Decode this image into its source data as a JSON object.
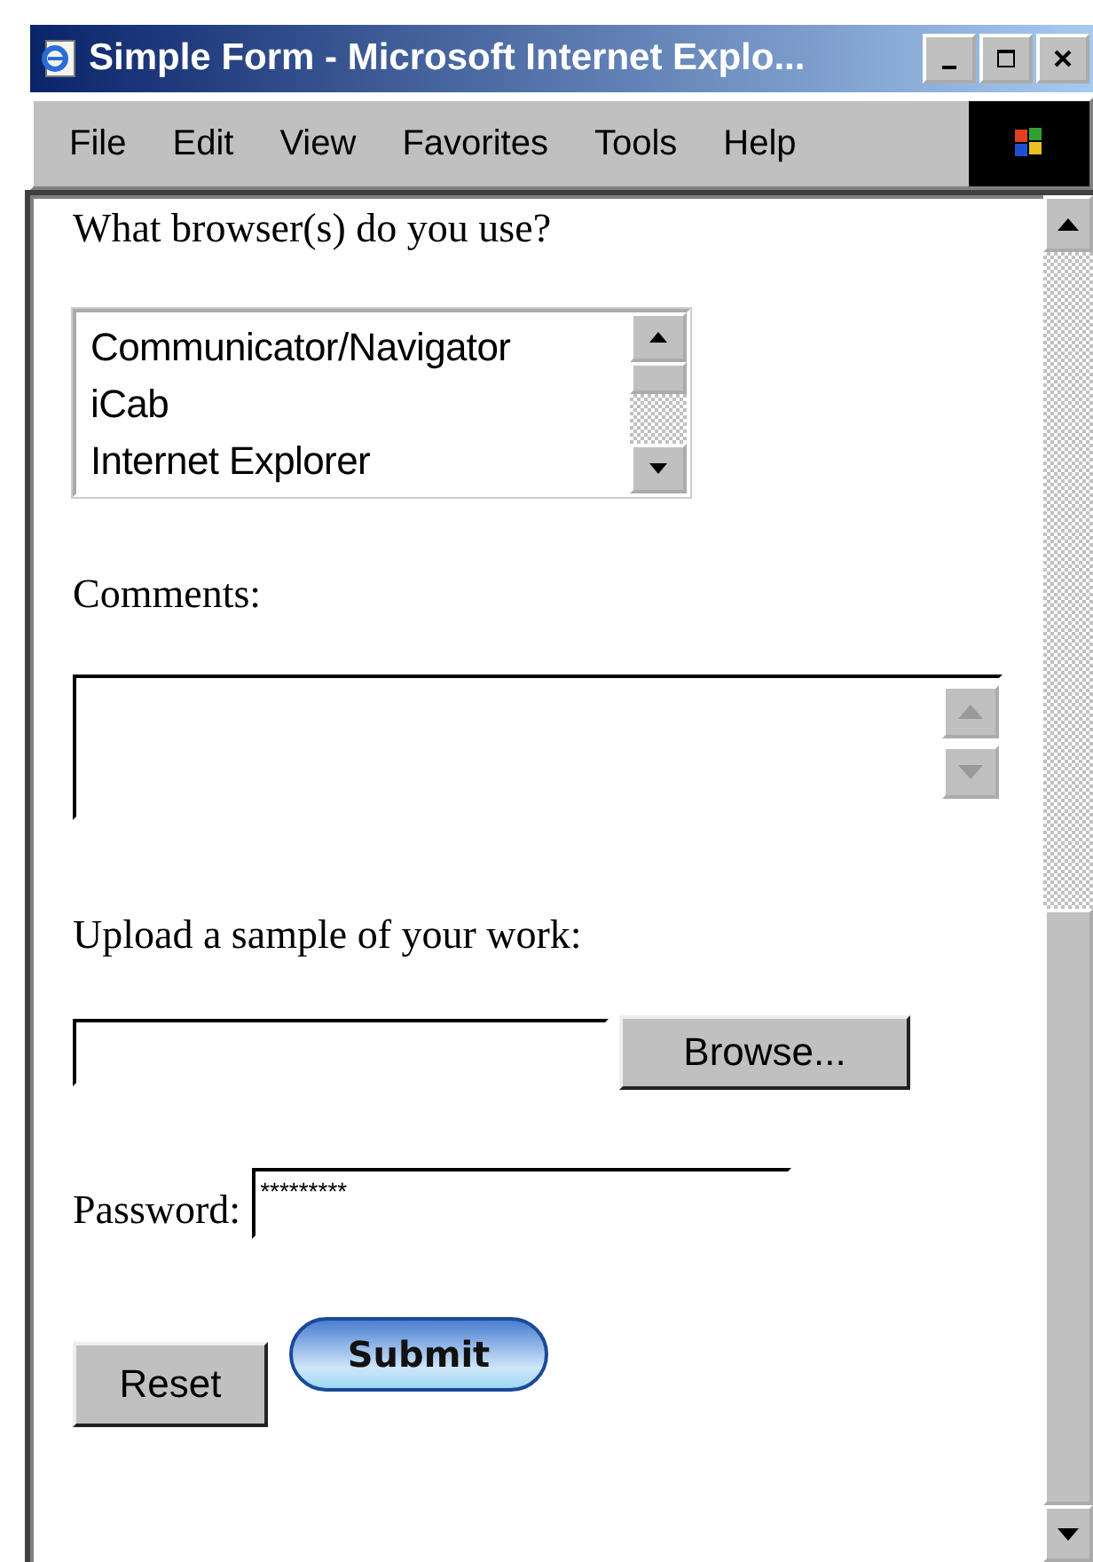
{
  "window": {
    "title": "Simple Form - Microsoft Internet Explo..."
  },
  "menu": [
    "File",
    "Edit",
    "View",
    "Favorites",
    "Tools",
    "Help"
  ],
  "form": {
    "browsers_label": "What browser(s) do you use?",
    "browsers": [
      {
        "label": "Communicator/Navigator",
        "selected": false
      },
      {
        "label": "iCab",
        "selected": false
      },
      {
        "label": "Internet Explorer",
        "selected": false
      }
    ],
    "comments_label": "Comments:",
    "upload_label": "Upload a sample of your work:",
    "browse_button": "Browse...",
    "password_label": "Password:",
    "password_value": "*********",
    "reset_button": "Reset",
    "submit_button": "Submit"
  }
}
